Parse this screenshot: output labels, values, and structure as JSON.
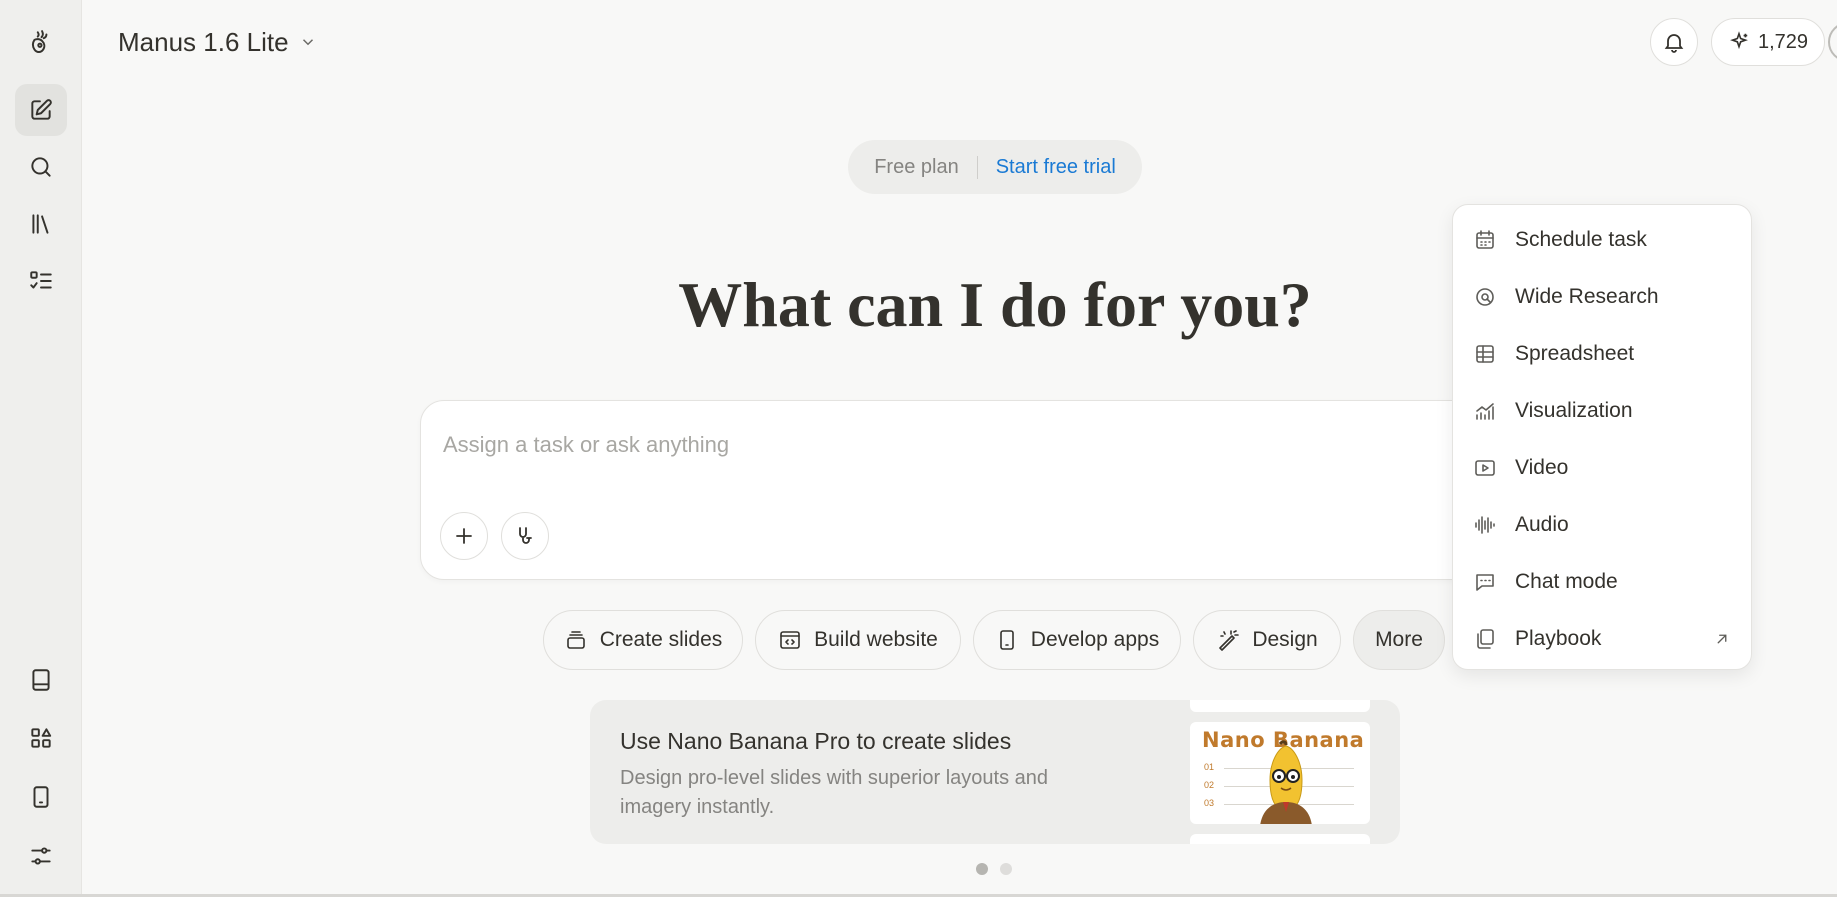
{
  "header": {
    "model_label": "Manus 1.6 Lite",
    "credits": "1,729"
  },
  "plan": {
    "free_label": "Free plan",
    "trial_label": "Start free trial"
  },
  "main": {
    "headline": "What can I do for you?",
    "input_placeholder": "Assign a task or ask anything"
  },
  "quick_actions": {
    "create_slides": "Create slides",
    "build_website": "Build website",
    "develop_apps": "Develop apps",
    "design": "Design",
    "more": "More"
  },
  "promo": {
    "title": "Use Nano Banana Pro to create slides",
    "description": "Design pro-level slides with superior layouts and imagery instantly.",
    "thumb_brand": "Nano Banana",
    "thumb_rows": [
      "01",
      "02",
      "03"
    ]
  },
  "menu": {
    "schedule_task": "Schedule task",
    "wide_research": "Wide Research",
    "spreadsheet": "Spreadsheet",
    "visualization": "Visualization",
    "video": "Video",
    "audio": "Audio",
    "chat_mode": "Chat mode",
    "playbook": "Playbook"
  },
  "icons": {
    "sidebar": [
      "logo-icon",
      "new-task-icon",
      "search-icon",
      "library-icon",
      "tasks-icon",
      "book-icon",
      "apps-icon",
      "mobile-icon",
      "settings-icon"
    ],
    "header": [
      "chevron-down-icon",
      "bell-icon",
      "sparkle-icon"
    ]
  },
  "colors": {
    "accent_link": "#1a7ad4",
    "text": "#34322d",
    "muted": "#858481",
    "background": "#f8f8f7",
    "banana_brand": "#c07a2c"
  },
  "carousel": {
    "current": 1,
    "total": 2
  }
}
